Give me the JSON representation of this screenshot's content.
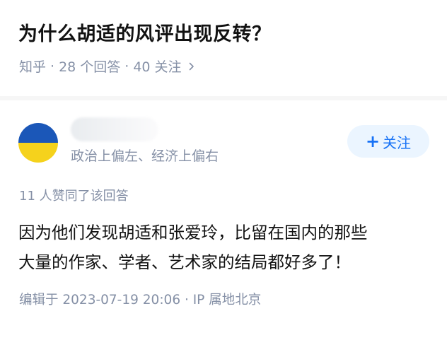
{
  "question": {
    "title": "为什么胡适的风评出现反转？",
    "source": "知乎",
    "answers": "28 个回答",
    "followers": "40 关注",
    "separator": "·"
  },
  "answer": {
    "author_bio": "政治上偏左、经济上偏右",
    "follow_label": "关注",
    "follow_icon": "+",
    "vote_summary": "11 人赞同了该回答",
    "content": [
      "因为他们发现胡适和张爱玲，比留在国内的那些",
      "大量的作家、学者、艺术家的结局都好多了！"
    ],
    "edited": "编辑于 2023-07-19 20:06 · IP 属地北京"
  },
  "colors": {
    "accent": "#1772f6",
    "follow_bg": "#ebf5ff",
    "meta_text": "#8590a6",
    "avatar_top": "#1b57b8",
    "avatar_bottom": "#f5d21c"
  },
  "icons": {
    "meta_arrow": "chevron-right-icon",
    "follow": "plus-icon"
  }
}
